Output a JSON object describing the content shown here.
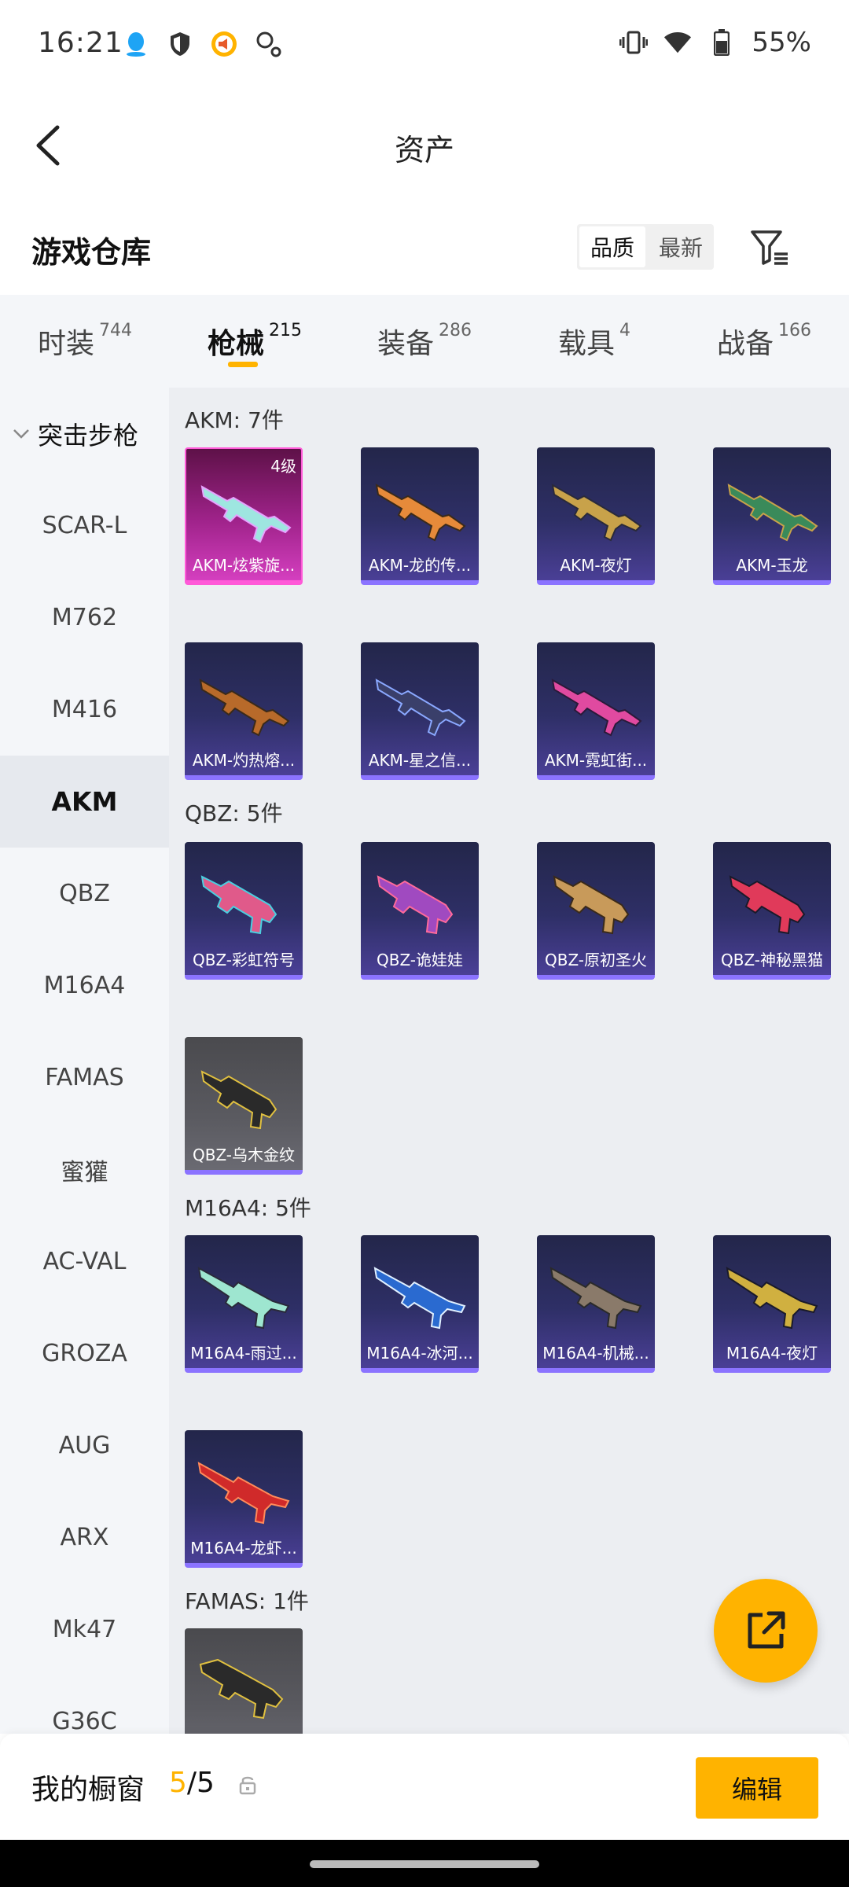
{
  "status_bar": {
    "time": "16:21",
    "battery": "55%",
    "left_icons": [
      "qq-icon",
      "shield-icon",
      "speaker-badge-icon",
      "location-search-icon"
    ],
    "right_icons": [
      "vibrate-icon",
      "wifi-icon",
      "battery-icon"
    ]
  },
  "header": {
    "title": "资产"
  },
  "warehouse": {
    "title": "游戏仓库",
    "sort_options": [
      "品质",
      "最新"
    ]
  },
  "categories": [
    {
      "label": "时装",
      "count": "744"
    },
    {
      "label": "枪械",
      "count": "215"
    },
    {
      "label": "装备",
      "count": "286"
    },
    {
      "label": "载具",
      "count": "4"
    },
    {
      "label": "战备",
      "count": "166"
    }
  ],
  "sidebar": {
    "group": "突击步枪",
    "items": [
      "SCAR-L",
      "M762",
      "M416",
      "AKM",
      "QBZ",
      "M16A4",
      "FAMAS",
      "蜜獾",
      "AC-VAL",
      "GROZA",
      "AUG",
      "ARX",
      "Mk47",
      "G36C"
    ]
  },
  "sections": [
    {
      "title": "AKM: 7件",
      "items": [
        {
          "label": "AKM-炫紫旋...",
          "badge": "4级"
        },
        {
          "label": "AKM-龙的传..."
        },
        {
          "label": "AKM-夜灯"
        },
        {
          "label": "AKM-玉龙"
        },
        {
          "label": "AKM-灼热熔..."
        },
        {
          "label": "AKM-星之信..."
        },
        {
          "label": "AKM-霓虹街..."
        }
      ]
    },
    {
      "title": "QBZ: 5件",
      "items": [
        {
          "label": "QBZ-彩虹符号"
        },
        {
          "label": "QBZ-诡娃娃"
        },
        {
          "label": "QBZ-原初圣火"
        },
        {
          "label": "QBZ-神秘黑猫"
        },
        {
          "label": "QBZ-乌木金纹"
        }
      ]
    },
    {
      "title": "M16A4: 5件",
      "items": [
        {
          "label": "M16A4-雨过..."
        },
        {
          "label": "M16A4-冰河..."
        },
        {
          "label": "M16A4-机械..."
        },
        {
          "label": "M16A4-夜灯"
        },
        {
          "label": "M16A4-龙虾..."
        }
      ]
    },
    {
      "title": "FAMAS: 1件",
      "items": []
    }
  ],
  "bottom_bar": {
    "title": "我的橱窗",
    "count_current": "5",
    "count_sep_total": "/5",
    "edit_label": "编辑"
  },
  "colors": {
    "accent": "#ffb300",
    "card_purple": "#4a3f96",
    "card_legend": "#d43fbf"
  }
}
